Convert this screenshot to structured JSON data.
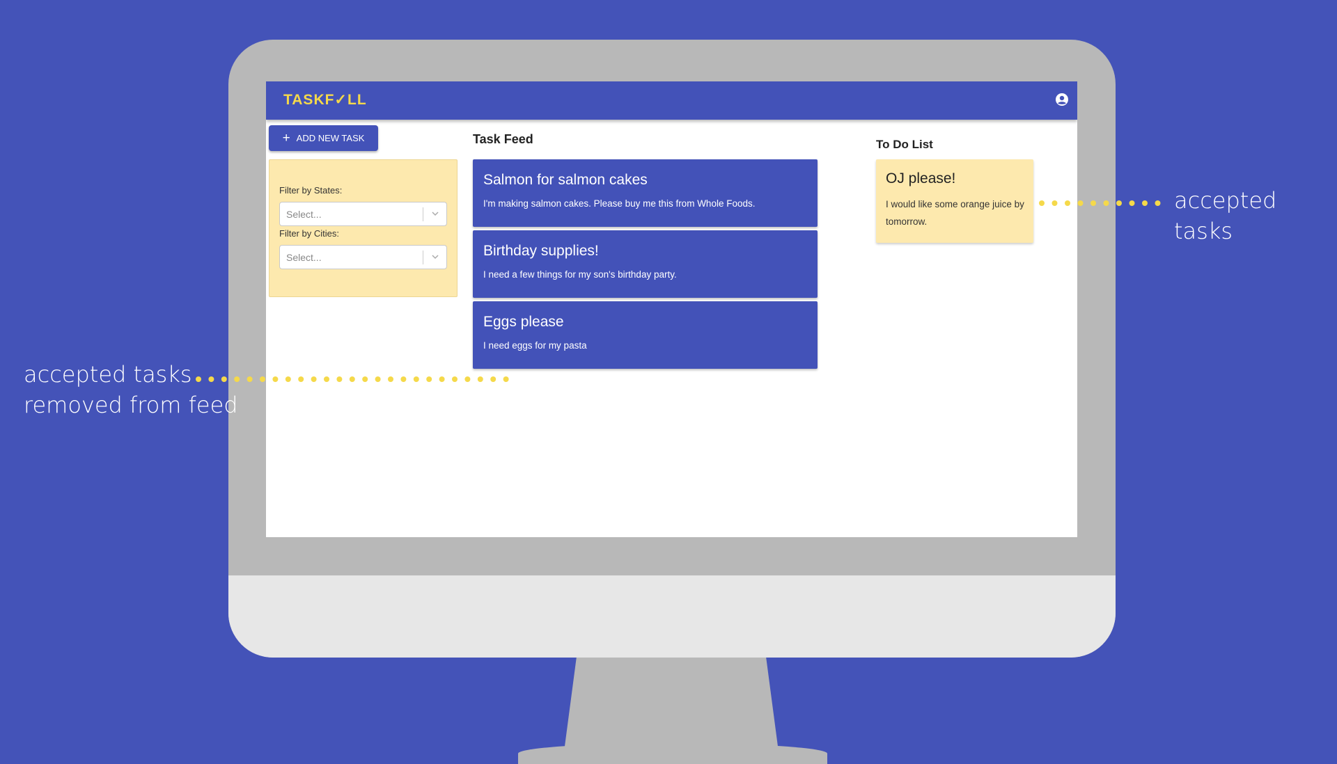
{
  "app": {
    "logo": "TASKF✓LL",
    "add_task_label": "ADD NEW TASK"
  },
  "filters": {
    "states_label": "Filter by States:",
    "states_placeholder": "Select...",
    "cities_label": "Filter by Cities:",
    "cities_placeholder": "Select..."
  },
  "feed": {
    "title": "Task Feed",
    "tasks": [
      {
        "title": "Salmon for salmon cakes",
        "description": "I'm making salmon cakes. Please buy me this from Whole Foods."
      },
      {
        "title": "Birthday supplies!",
        "description": "I need a few things for my son's birthday party."
      },
      {
        "title": "Eggs please",
        "description": "I need eggs for my pasta"
      }
    ]
  },
  "todo": {
    "title": "To Do List",
    "items": [
      {
        "title": "OJ please!",
        "description": "I would like some orange juice by tomorrow."
      }
    ]
  },
  "annotations": {
    "right": "accepted tasks",
    "left_line1": "accepted tasks",
    "left_line2": "removed from feed"
  },
  "colors": {
    "background": "#4453b8",
    "navbar": "#4352b8",
    "accent_yellow": "#f5d94a",
    "panel_yellow": "#fde9ae"
  }
}
